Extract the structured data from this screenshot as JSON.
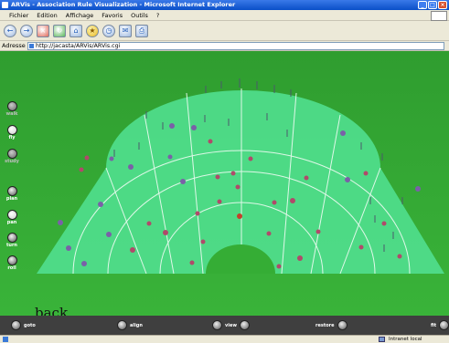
{
  "window": {
    "title": "ARVis - Association Rule Visualization - Microsoft Internet Explorer"
  },
  "menu": [
    "Fichier",
    "Edition",
    "Affichage",
    "Favoris",
    "Outils",
    "?"
  ],
  "address": {
    "label": "Adresse",
    "url": "http://jacasta/ARVis/ARVis.cgi"
  },
  "sidebar": [
    {
      "label": "walk"
    },
    {
      "label": "fly"
    },
    {
      "label": "study"
    },
    {
      "label": "plan"
    },
    {
      "label": "pan"
    },
    {
      "label": "turn"
    },
    {
      "label": "roll"
    }
  ],
  "scene": {
    "back_label": "back"
  },
  "bottom": {
    "goto": "goto",
    "align": "align",
    "view": "view",
    "restore": "restore",
    "fit": "fit"
  },
  "status": {
    "zone": "Intranet local"
  },
  "colors": {
    "grass": "#2e9e2e",
    "arena": "#4fdc8a",
    "grid": "#dff8e8",
    "ui_bar": "#3f3f3f"
  }
}
